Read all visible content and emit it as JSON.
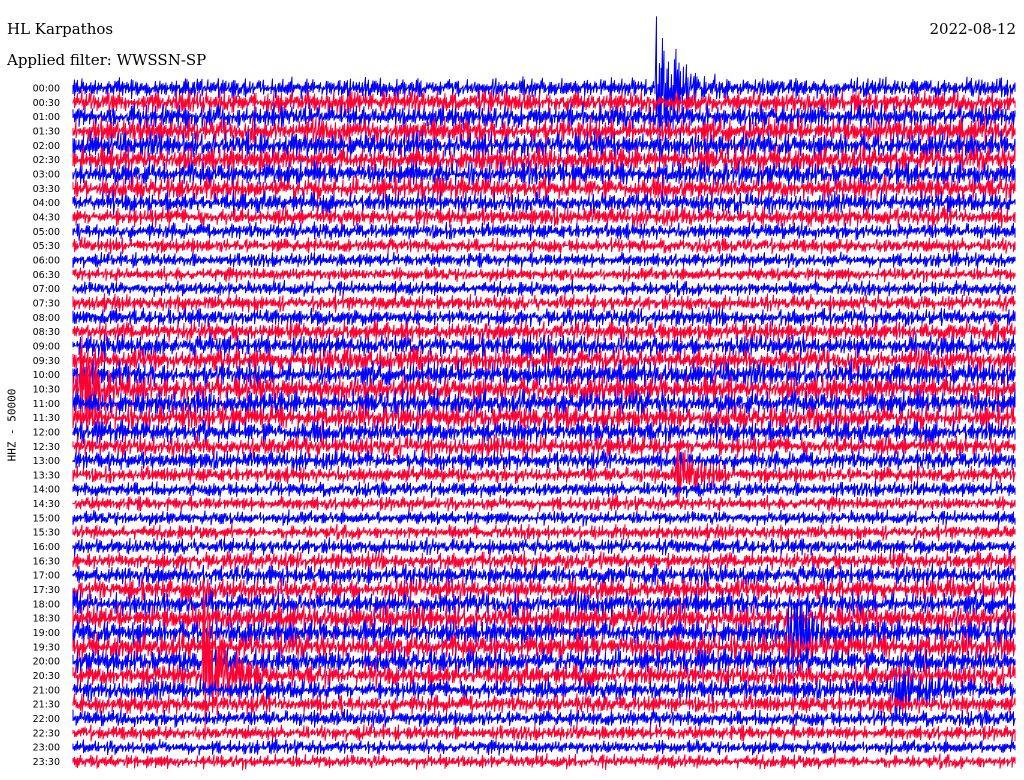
{
  "header": {
    "station": "HL Karpathos",
    "date": "2022-08-12",
    "filter": "Applied filter: WWSSN-SP"
  },
  "chart_data": {
    "type": "line",
    "title": "HL Karpathos",
    "date": "2022-08-12",
    "ylabel": "HHZ - 50000",
    "row_labels": [
      "00:00",
      "00:30",
      "01:00",
      "01:30",
      "02:00",
      "02:30",
      "03:00",
      "03:30",
      "04:00",
      "04:30",
      "05:00",
      "05:30",
      "06:00",
      "06:30",
      "07:00",
      "07:30",
      "08:00",
      "08:30",
      "09:00",
      "09:30",
      "10:00",
      "10:30",
      "11:00",
      "11:30",
      "12:00",
      "12:30",
      "13:00",
      "13:30",
      "14:00",
      "14:30",
      "15:00",
      "15:30",
      "16:00",
      "16:30",
      "17:00",
      "17:30",
      "18:00",
      "18:30",
      "19:00",
      "19:30",
      "20:00",
      "20:30",
      "21:00",
      "21:30",
      "22:00",
      "22:30",
      "23:00",
      "23:30"
    ],
    "colors": [
      "#0000ff",
      "#ff0033"
    ],
    "grid": false,
    "events": [
      {
        "row_start": "00:00",
        "position": 0.62,
        "strength": 1.0
      },
      {
        "row_start": "10:30",
        "position": 0.01,
        "strength": 0.5
      },
      {
        "row_start": "13:30",
        "position": 0.64,
        "strength": 0.3
      },
      {
        "row_start": "19:00",
        "position": 0.76,
        "strength": 0.45
      },
      {
        "row_start": "20:30",
        "position": 0.14,
        "strength": 0.9
      },
      {
        "row_start": "21:00",
        "position": 0.87,
        "strength": 0.3
      }
    ]
  }
}
